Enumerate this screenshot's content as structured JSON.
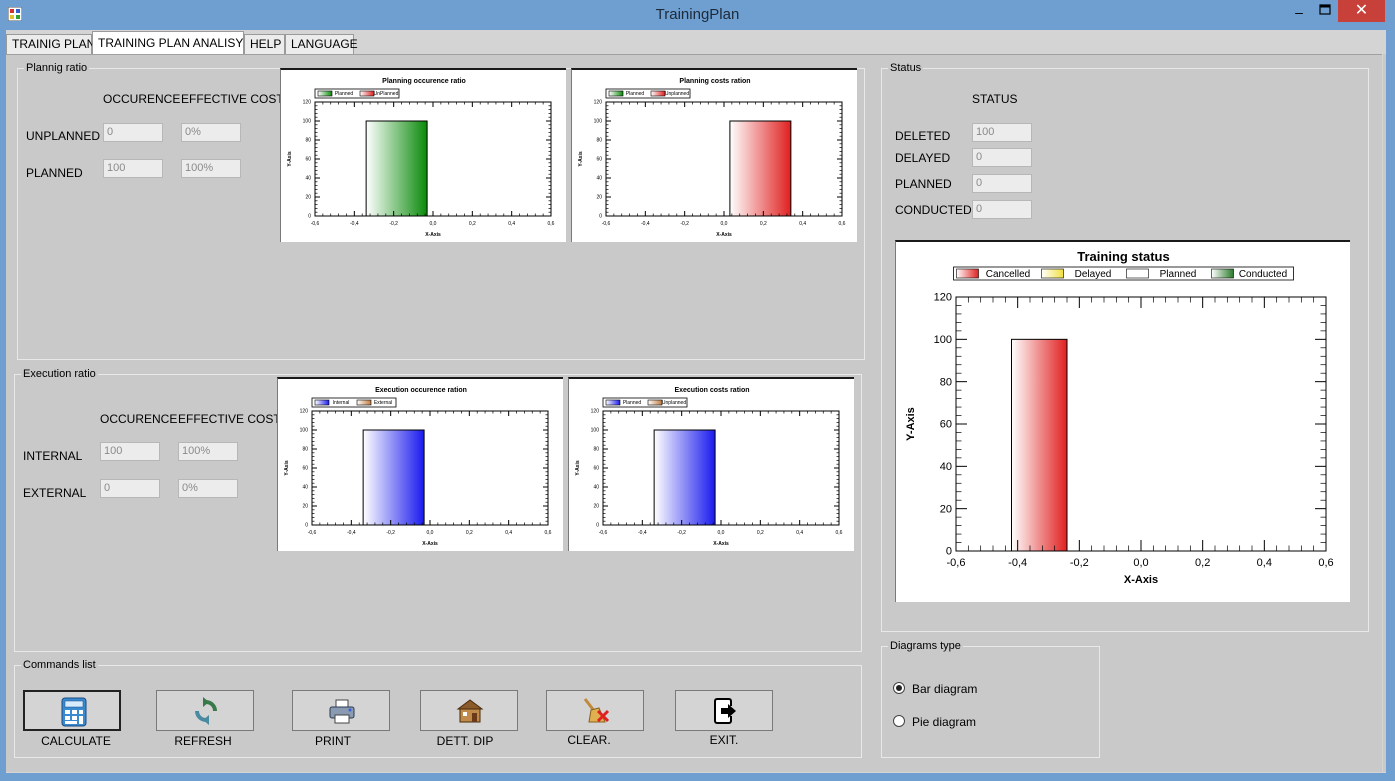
{
  "window": {
    "title": "TrainingPlan",
    "minimize": "–",
    "close": "✕"
  },
  "tabs": [
    "TRAINIG PLAN",
    "TRAINING PLAN ANALISYS",
    "HELP",
    "LANGUAGE"
  ],
  "planning": {
    "group_title": "Plannig ratio",
    "col_occurence": "OCCURENCE",
    "col_cost": "EFFECTIVE COST",
    "rows": [
      {
        "label": "UNPLANNED",
        "occurence": "0",
        "cost": "0%"
      },
      {
        "label": "PLANNED",
        "occurence": "100",
        "cost": "100%"
      }
    ]
  },
  "execution": {
    "group_title": "Execution ratio",
    "col_occurence": "OCCURENCE",
    "col_cost": "EFFECTIVE COST",
    "rows": [
      {
        "label": "INTERNAL",
        "occurence": "100",
        "cost": "100%"
      },
      {
        "label": "EXTERNAL",
        "occurence": "0",
        "cost": "0%"
      }
    ]
  },
  "status": {
    "group_title": "Status",
    "header": "STATUS",
    "rows": [
      {
        "label": "DELETED",
        "value": "100"
      },
      {
        "label": "DELAYED",
        "value": "0"
      },
      {
        "label": "PLANNED",
        "value": "0"
      },
      {
        "label": "CONDUCTED",
        "value": "0"
      }
    ]
  },
  "commands": {
    "group_title": "Commands list",
    "buttons": [
      {
        "label": "CALCULATE",
        "icon": "calculator-icon"
      },
      {
        "label": "REFRESH",
        "icon": "refresh-icon"
      },
      {
        "label": "PRINT",
        "icon": "printer-icon"
      },
      {
        "label": "DETT. DIP",
        "icon": "house-icon"
      },
      {
        "label": "CLEAR.",
        "icon": "broom-icon"
      },
      {
        "label": "EXIT.",
        "icon": "exit-icon"
      }
    ]
  },
  "diagrams": {
    "group_title": "Diagrams type",
    "options": [
      {
        "label": "Bar diagram",
        "checked": true
      },
      {
        "label": "Pie diagram",
        "checked": false
      }
    ]
  },
  "chart_data": [
    {
      "type": "bar",
      "title": "Planning occurence ratio",
      "xlabel": "X-Axis",
      "ylabel": "Y-Axis",
      "xlim": [
        -0.6,
        0.6
      ],
      "ylim": [
        0,
        120
      ],
      "xticks": [
        "-0,6",
        "-0,4",
        "-0,2",
        "0,0",
        "0,2",
        "0,4",
        "0,6"
      ],
      "yticks": [
        "0",
        "20",
        "40",
        "60",
        "80",
        "100",
        "120"
      ],
      "legend": "top-left",
      "series": [
        {
          "name": "Planned",
          "x_start": -0.34,
          "x_end": -0.03,
          "value": 100,
          "color": "#0a8a0a"
        },
        {
          "name": "UnPlanned",
          "x_start": 0.03,
          "x_end": 0.34,
          "value": 0,
          "color": "#e02020"
        }
      ]
    },
    {
      "type": "bar",
      "title": "Planning costs ration",
      "xlabel": "X-Axis",
      "ylabel": "Y-Axis",
      "xlim": [
        -0.6,
        0.6
      ],
      "ylim": [
        0,
        120
      ],
      "xticks": [
        "-0,6",
        "-0,4",
        "-0,2",
        "0,0",
        "0,2",
        "0,4",
        "0,6"
      ],
      "yticks": [
        "0",
        "20",
        "40",
        "60",
        "80",
        "100",
        "120"
      ],
      "legend": "top-left",
      "series": [
        {
          "name": "Planned",
          "x_start": -0.34,
          "x_end": -0.03,
          "value": 0,
          "color": "#0a8a0a"
        },
        {
          "name": "Unplanned",
          "x_start": 0.03,
          "x_end": 0.34,
          "value": 100,
          "color": "#e02020"
        }
      ]
    },
    {
      "type": "bar",
      "title": "Execution occurence ration",
      "xlabel": "X-Axis",
      "ylabel": "Y-Axis",
      "xlim": [
        -0.6,
        0.6
      ],
      "ylim": [
        0,
        120
      ],
      "xticks": [
        "-0,6",
        "-0,4",
        "-0,2",
        "0,0",
        "0,2",
        "0,4",
        "0,6"
      ],
      "yticks": [
        "0",
        "20",
        "40",
        "60",
        "80",
        "100",
        "120"
      ],
      "legend": "top-left",
      "series": [
        {
          "name": "Internal",
          "x_start": -0.34,
          "x_end": -0.03,
          "value": 100,
          "color": "#1a1aee"
        },
        {
          "name": "External",
          "x_start": 0.03,
          "x_end": 0.34,
          "value": 0,
          "color": "#c07a40"
        }
      ]
    },
    {
      "type": "bar",
      "title": "Execution costs ration",
      "xlabel": "X-Axis",
      "ylabel": "Y-Axis",
      "xlim": [
        -0.6,
        0.6
      ],
      "ylim": [
        0,
        120
      ],
      "xticks": [
        "-0,6",
        "-0,4",
        "-0,2",
        "0,0",
        "0,2",
        "0,4",
        "0,6"
      ],
      "yticks": [
        "0",
        "20",
        "40",
        "60",
        "80",
        "100",
        "120"
      ],
      "legend": "top-left",
      "series": [
        {
          "name": "Planned",
          "x_start": -0.34,
          "x_end": -0.03,
          "value": 100,
          "color": "#1a1aee"
        },
        {
          "name": "Unplanned",
          "x_start": 0.03,
          "x_end": 0.34,
          "value": 0,
          "color": "#c07a40"
        }
      ]
    },
    {
      "type": "bar",
      "title": "Training status",
      "xlabel": "X-Axis",
      "ylabel": "Y-Axis",
      "xlim": [
        -0.6,
        0.6
      ],
      "ylim": [
        0,
        120
      ],
      "xticks": [
        "-0,6",
        "-0,4",
        "-0,2",
        "0,0",
        "0,2",
        "0,4",
        "0,6"
      ],
      "yticks": [
        "0",
        "20",
        "40",
        "60",
        "80",
        "100",
        "120"
      ],
      "legend": "top",
      "series": [
        {
          "name": "Cancelled",
          "x_start": -0.42,
          "x_end": -0.24,
          "value": 100,
          "color": "#e02020"
        },
        {
          "name": "Delayed",
          "x_start": -0.2,
          "x_end": -0.02,
          "value": 0,
          "color": "#f0e040"
        },
        {
          "name": "Planned",
          "x_start": 0.02,
          "x_end": 0.2,
          "value": 0,
          "color": "#ffffff"
        },
        {
          "name": "Conducted",
          "x_start": 0.24,
          "x_end": 0.42,
          "value": 0,
          "color": "#2a7a2a"
        }
      ]
    }
  ]
}
